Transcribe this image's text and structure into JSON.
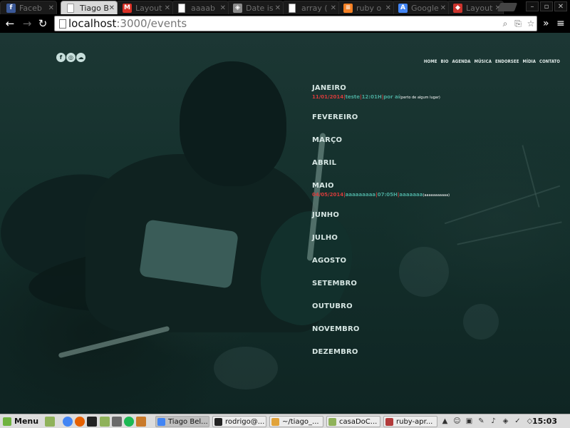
{
  "browser": {
    "tabs": [
      {
        "label": "Faceb",
        "icon": "facebook-icon",
        "color": "#3b5998",
        "glyph": "f"
      },
      {
        "label": "Tiago B",
        "icon": "document-icon",
        "color": "#ffffff",
        "glyph": "",
        "active": true
      },
      {
        "label": "Layout",
        "icon": "gmail-icon",
        "color": "#d93025",
        "glyph": "M"
      },
      {
        "label": "aaaab",
        "icon": "document-icon",
        "color": "#ffffff",
        "glyph": ""
      },
      {
        "label": "Date is",
        "icon": "puzzle-icon",
        "color": "#8a8a8a",
        "glyph": "◈"
      },
      {
        "label": "array (",
        "icon": "document-icon",
        "color": "#ffffff",
        "glyph": ""
      },
      {
        "label": "ruby o",
        "icon": "stack-icon",
        "color": "#f48024",
        "glyph": "≡"
      },
      {
        "label": "Google",
        "icon": "translate-icon",
        "color": "#4285f4",
        "glyph": "A"
      },
      {
        "label": "Layout",
        "icon": "ruby-icon",
        "color": "#cc342d",
        "glyph": "◆"
      }
    ],
    "url_host": "localhost",
    "url_path": ":3000/events"
  },
  "page": {
    "nav": [
      "HOME",
      "BIO",
      "AGENDA",
      "MÚSICA",
      "ENDORSEE",
      "MÍDIA",
      "CONTATO"
    ],
    "social": [
      {
        "name": "facebook-icon",
        "glyph": "f"
      },
      {
        "name": "instagram-icon",
        "glyph": "◎"
      },
      {
        "name": "soundcloud-icon",
        "glyph": "☁"
      }
    ],
    "months": [
      {
        "name": "JANEIRO",
        "events": [
          {
            "date": "11/01/2014",
            "title": "teste",
            "time": "12:01H",
            "place": "por aí",
            "extra": "(perto de algum lugar)"
          }
        ]
      },
      {
        "name": "FEVEREIRO",
        "events": []
      },
      {
        "name": "MARÇO",
        "events": []
      },
      {
        "name": "ABRIL",
        "events": []
      },
      {
        "name": "MAIO",
        "events": [
          {
            "date": "04/05/2014",
            "title": "aaaaaaaaa",
            "time": "07:05H",
            "place": "aaaaaaa",
            "extra": "(aaaaaaaaaaa)"
          }
        ]
      },
      {
        "name": "JUNHO",
        "events": []
      },
      {
        "name": "JULHO",
        "events": []
      },
      {
        "name": "AGOSTO",
        "events": []
      },
      {
        "name": "SETEMBRO",
        "events": []
      },
      {
        "name": "OUTUBRO",
        "events": []
      },
      {
        "name": "NOVEMBRO",
        "events": []
      },
      {
        "name": "DEZEMBRO",
        "events": []
      }
    ]
  },
  "taskbar": {
    "menu_label": "Menu",
    "tasks": [
      {
        "label": "Tiago Bel...",
        "icon": "chrome-icon",
        "color": "#4285f4",
        "active": true
      },
      {
        "label": "rodrigo@...",
        "icon": "terminal-icon",
        "color": "#222222"
      },
      {
        "label": "~/tiago_...",
        "icon": "folder-icon",
        "color": "#e1a33a"
      },
      {
        "label": "casaDoC...",
        "icon": "folder-icon",
        "color": "#8fb25a"
      },
      {
        "label": "ruby-apr...",
        "icon": "image-icon",
        "color": "#b33b3b"
      }
    ],
    "clock": "15:03"
  }
}
